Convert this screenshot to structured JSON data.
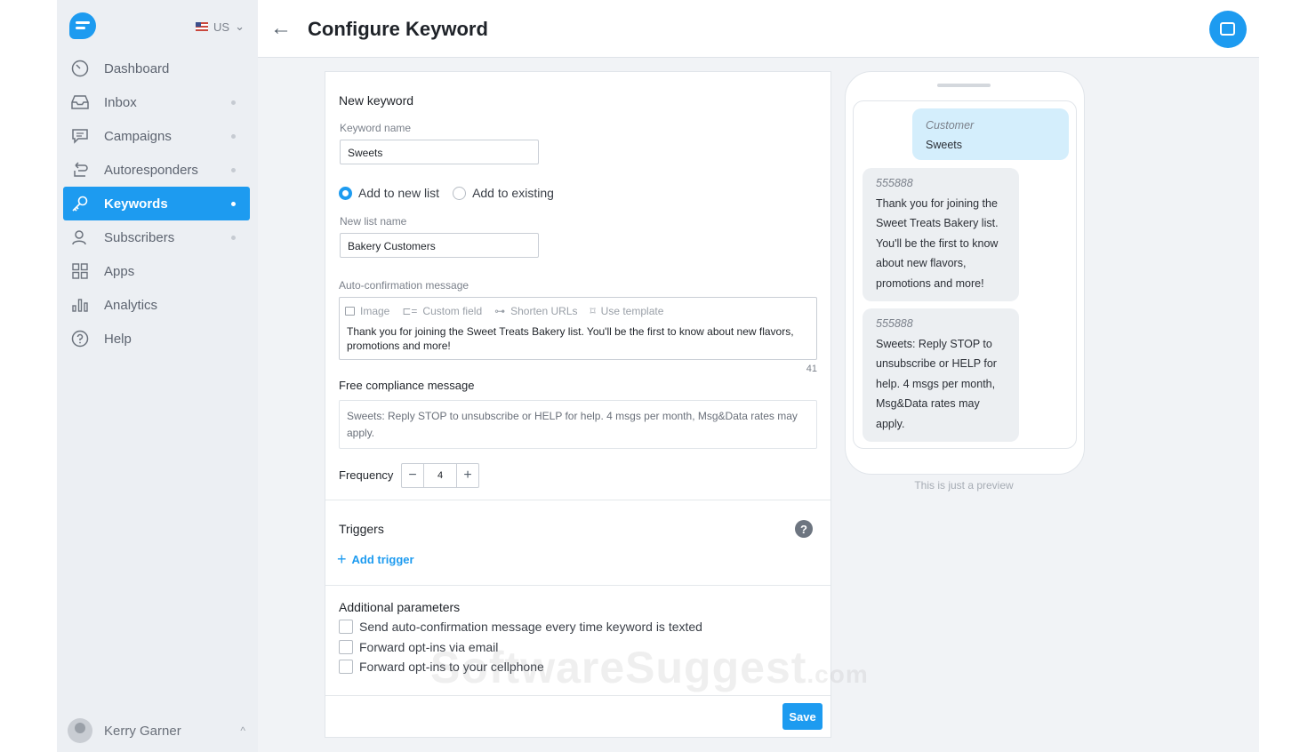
{
  "region": "US",
  "sidebar": {
    "items": [
      {
        "label": "Dashboard",
        "icon": "dashboard-icon"
      },
      {
        "label": "Inbox",
        "icon": "inbox-icon"
      },
      {
        "label": "Campaigns",
        "icon": "campaigns-icon"
      },
      {
        "label": "Autoresponders",
        "icon": "autoresponder-icon"
      },
      {
        "label": "Keywords",
        "icon": "key-icon"
      },
      {
        "label": "Subscribers",
        "icon": "subscribers-icon"
      },
      {
        "label": "Apps",
        "icon": "apps-grid-icon"
      },
      {
        "label": "Analytics",
        "icon": "analytics-icon"
      },
      {
        "label": "Help",
        "icon": "help-icon"
      }
    ],
    "active": "Keywords",
    "user_name": "Kerry Garner"
  },
  "header": {
    "title": "Configure Keyword"
  },
  "form": {
    "section_title": "New keyword",
    "keyword_name_label": "Keyword name",
    "keyword_name_value": "Sweets",
    "radio_new_list": "Add to new list",
    "radio_existing": "Add to existing",
    "selected_radio": "new",
    "new_list_label": "New list name",
    "new_list_value": "Bakery Customers",
    "auto_confirm_label": "Auto-confirmation message",
    "toolbar": {
      "image": "Image",
      "custom_field": "Custom field",
      "shorten_urls": "Shorten URLs",
      "use_template": "Use template"
    },
    "auto_confirm_text": "Thank you for joining the Sweet Treats Bakery list. You'll be the first to know about new flavors, promotions and more!",
    "char_count": "41",
    "compliance_label": "Free compliance message",
    "compliance_text": "Sweets: Reply STOP to unsubscribe or HELP for help. 4 msgs per month, Msg&Data rates may apply.",
    "frequency_label": "Frequency",
    "frequency_value": "4",
    "triggers_title": "Triggers",
    "add_trigger": "Add trigger",
    "additional_title": "Additional parameters",
    "checkboxes": [
      "Send auto-confirmation message every time keyword is texted",
      "Forward opt-ins via email",
      "Forward opt-ins to your cellphone"
    ],
    "save_label": "Save"
  },
  "preview": {
    "customer_sender": "Customer",
    "customer_text": "Sweets",
    "reply_sender_1": "555888",
    "reply_text_1": "Thank you for joining the Sweet Treats Bakery list. You'll be the first to know about new flavors, promotions and more!",
    "reply_sender_2": "555888",
    "reply_text_2": "Sweets: Reply STOP to unsubscribe or HELP for help. 4 msgs per month, Msg&Data rates may apply.",
    "note": "This is just a preview"
  },
  "watermark": {
    "main": "SoftwareSuggest",
    "suffix": ".com"
  },
  "colors": {
    "accent": "#1d9bf0",
    "sidebar_bg": "#eceff3"
  }
}
